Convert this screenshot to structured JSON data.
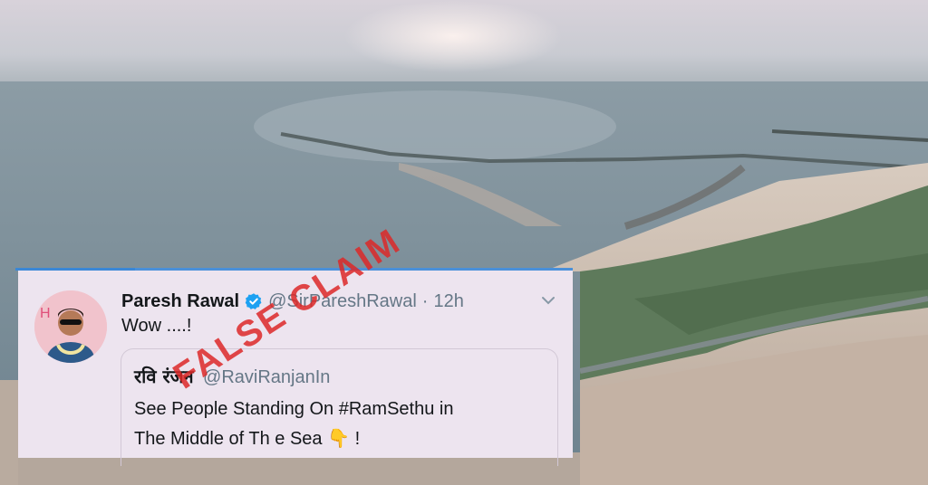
{
  "tweet": {
    "author_name": "Paresh Rawal",
    "handle": "@SirPareshRawal",
    "separator": "·",
    "time": "12h",
    "text": "Wow ....!",
    "icons": {
      "verified": "verified-badge-icon",
      "caret": "chevron-down-icon"
    }
  },
  "quoted_tweet": {
    "author_name": "रवि रंजन",
    "handle": "@RaviRanjanIn",
    "text_line1": "See People Standing On #RamSethu in",
    "text_line2": "The Middle of Th e Sea",
    "emoji": "👇",
    "exclaim": "!"
  },
  "stamp": {
    "label": "FALSE CLAIM",
    "color": "#dc2828"
  },
  "colors": {
    "card_bg": "#ede4ef",
    "accent": "#1da1f2",
    "text": "#14171a",
    "muted": "#657786"
  }
}
